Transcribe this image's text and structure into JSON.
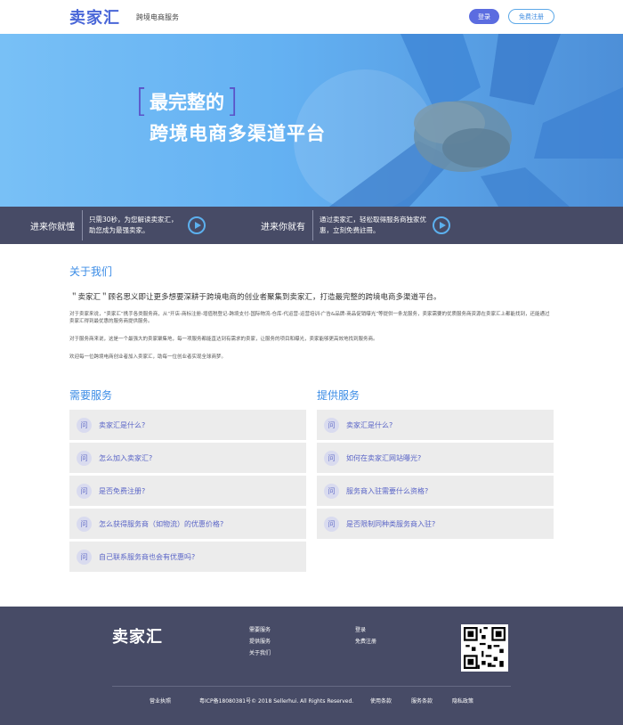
{
  "header": {
    "logo_text": "卖家汇",
    "tagline": "跨境电商服务",
    "login_label": "登录",
    "register_label": "免费注册"
  },
  "hero": {
    "line1": "最完整的",
    "line2": "跨境电商多渠道平台"
  },
  "strip": [
    {
      "title": "进来你就懂",
      "desc": "只需30秒，为您解读卖家汇，助您成为最强卖家。"
    },
    {
      "title": "进来你就有",
      "desc": "通过卖家汇，轻松取得服务商独家优惠，立刻免费註冊。"
    }
  ],
  "about": {
    "title": "关于我们",
    "intro": "＂卖家汇＂顾名思义即让更多想要深耕于跨境电商的创业者聚集到卖家汇，打造最完整的跨境电商多渠道平台。",
    "p1": "对于卖家来说，“卖家汇”携手各类服务商，从“开店-商标注册-增值税登记-跨境支付-国际物流-仓库-代运营-运营培训-广告&品牌-商品促销曝光”等提供一条龙服务，卖家需要的优质服务商资源在卖家汇上都能找到，还能通过卖家汇得到最优惠的服务商提供服务。",
    "p2": "对于服务商来说，这是一个最强大的卖家聚集地，每一项服务都能直达到有需求的卖家，让服务的项目和曝光，卖家能够更高效地找到服务商。",
    "p3": "欢迎每一位跨境电商创业者加入卖家汇，助每一位创业者实现全球商梦。"
  },
  "faq": {
    "need_title": "需要服务",
    "need_items": [
      "卖家汇是什么?",
      "怎么加入卖家汇?",
      "是否免费注册?",
      "怎么获得服务商（如物流）的优惠价格?",
      "自己联系服务商也会有优惠吗?"
    ],
    "provide_title": "提供服务",
    "provide_items": [
      "卖家汇是什么?",
      "如何在卖家汇网站曝光?",
      "服务商入驻需要什么资格?",
      "是否限制同种类服务商入驻?"
    ],
    "q_icon_char": "问"
  },
  "footer": {
    "logo_text": "卖家汇",
    "col1": [
      "需要服务",
      "提供服务",
      "关于我们"
    ],
    "col2": [
      "登录",
      "免费注册"
    ],
    "bottom": [
      "营业执照",
      "粤ICP备18080381号© 2018 Sellerhui. All Rights Reserved.",
      "使用条款",
      "服务条款",
      "隐私政策"
    ]
  },
  "colors": {
    "accent": "#3b8ce6",
    "dark": "#474b66",
    "brand": "#4a67d8"
  }
}
